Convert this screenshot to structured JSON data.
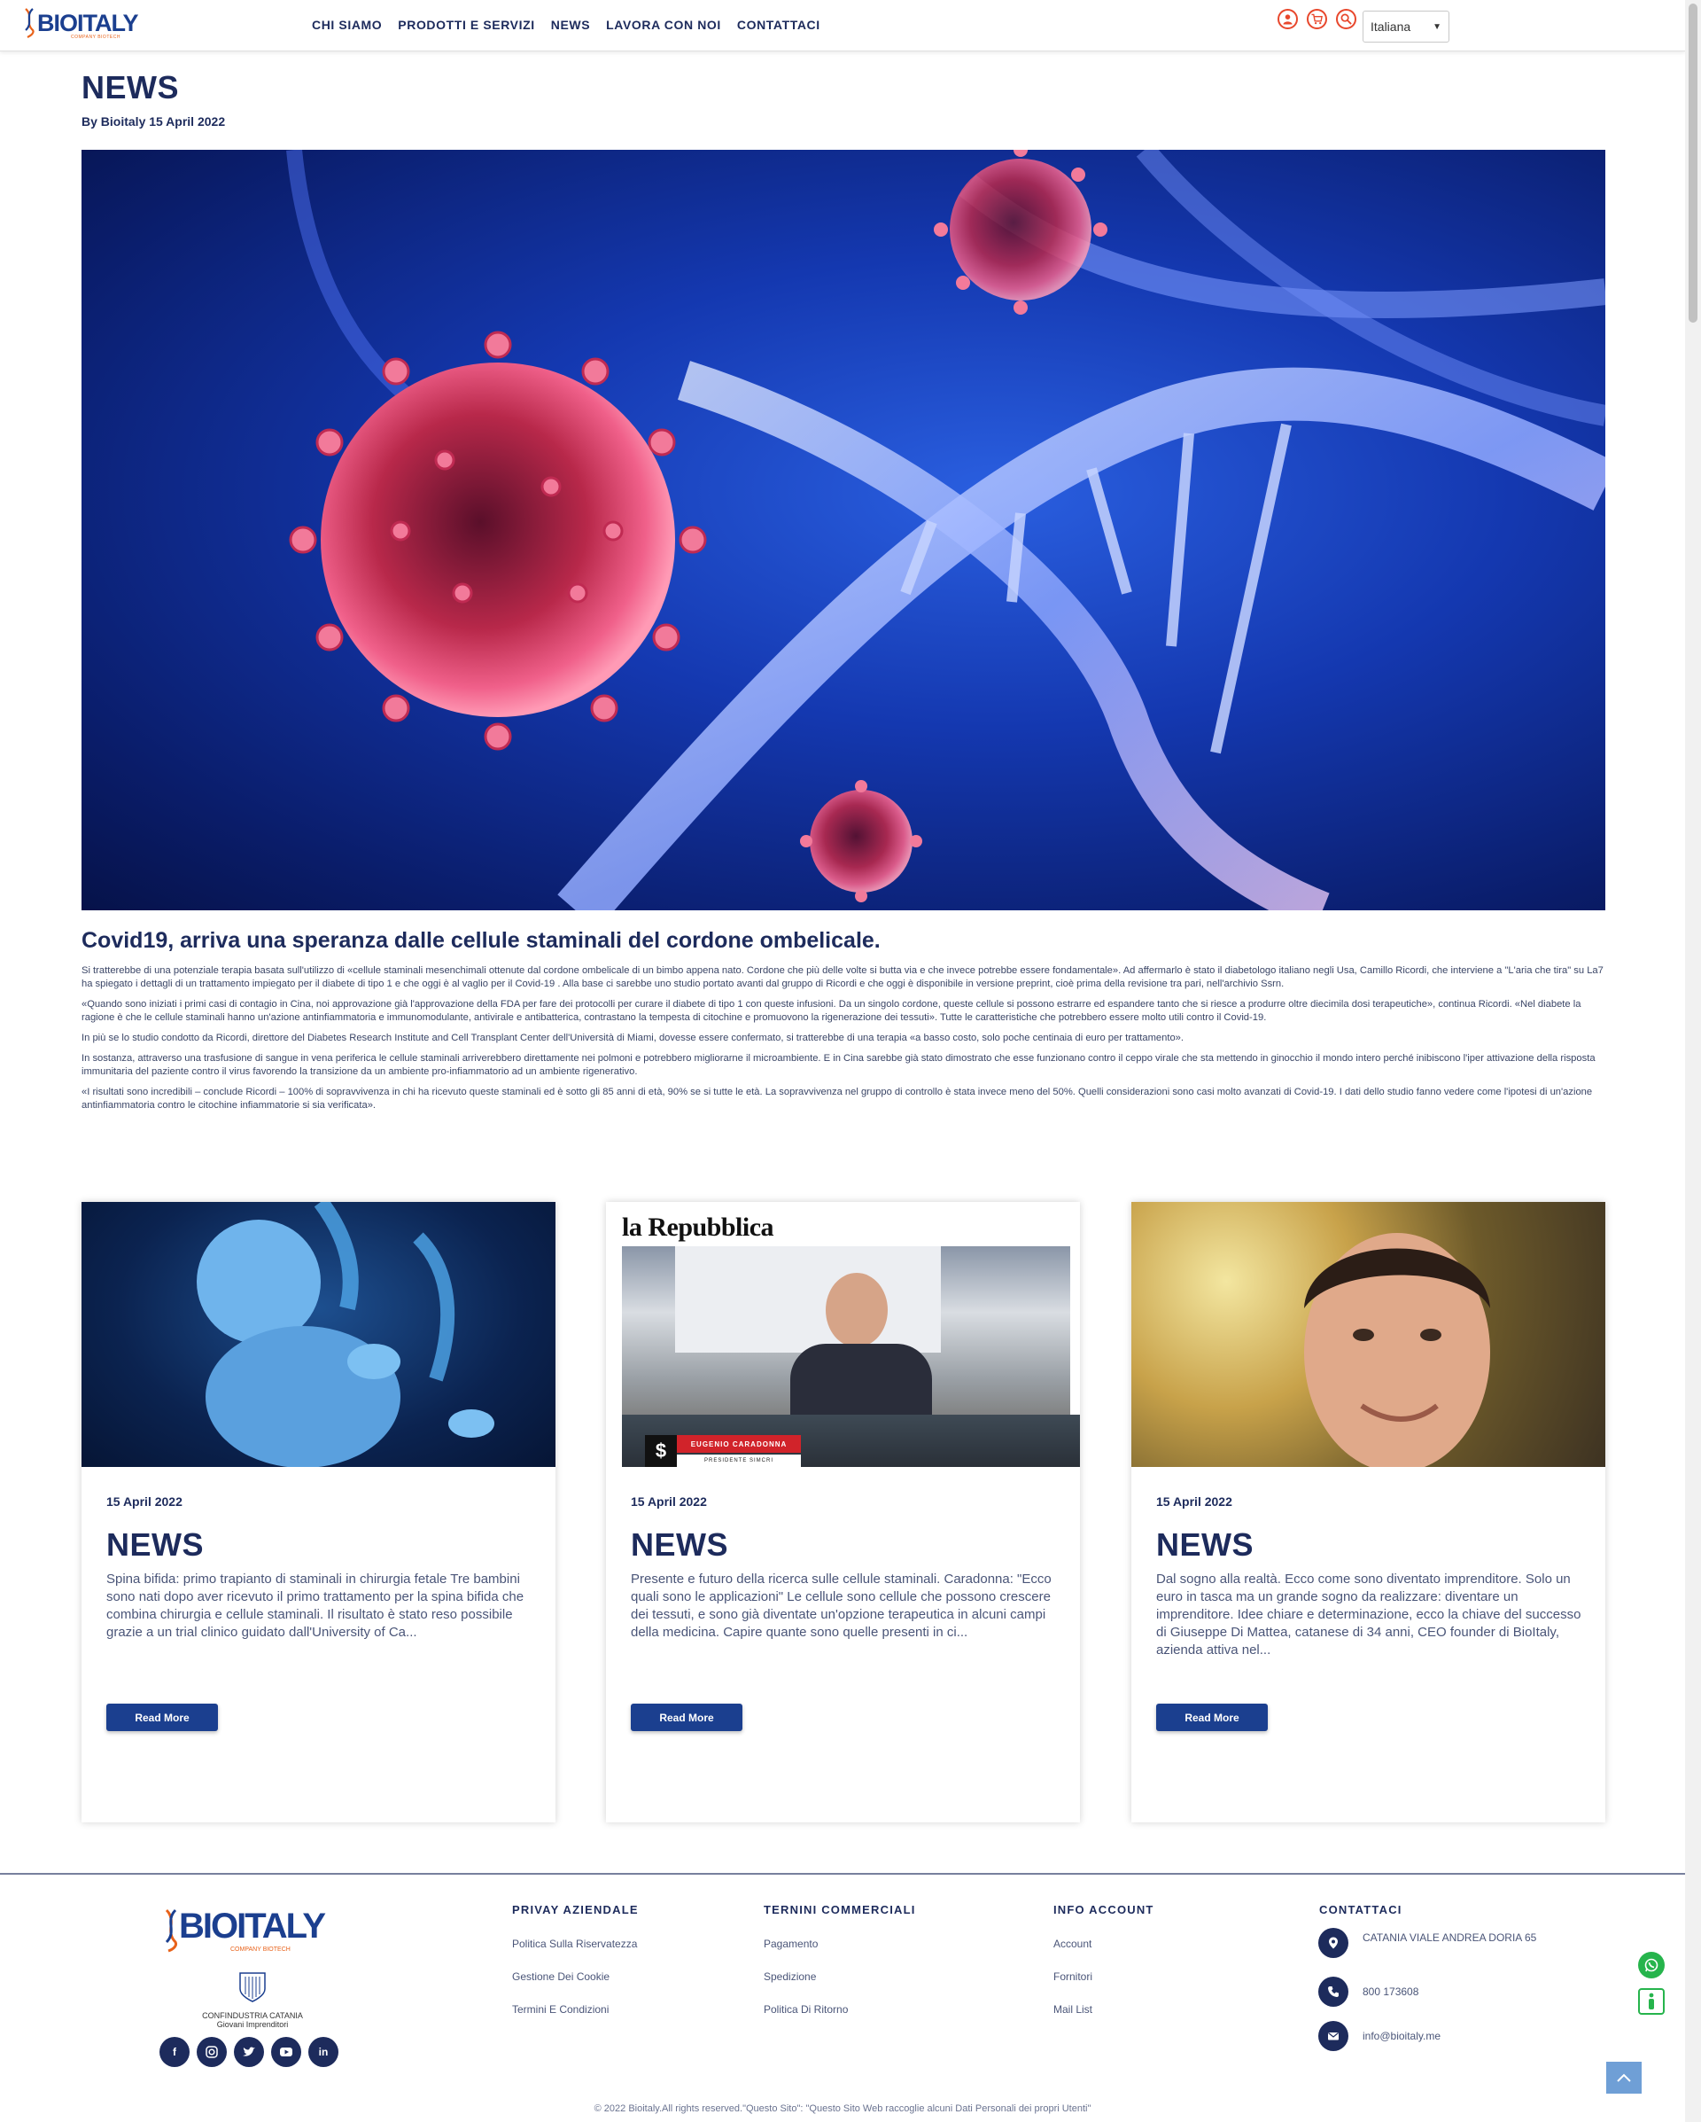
{
  "brand": {
    "name": "BIOITALY",
    "subtitle": "COMPANY BIOTECH",
    "accent_color": "#1b3f8f",
    "secondary_color": "#e8621a"
  },
  "nav": {
    "items": [
      "CHI SIAMO",
      "PRODOTTI E SERVIZI",
      "NEWS",
      "LAVORA CON NOI",
      "CONTATTACI"
    ]
  },
  "header_icons": [
    "user-icon",
    "cart-icon",
    "search-icon"
  ],
  "language": {
    "selected": "Italiana"
  },
  "article": {
    "title": "NEWS",
    "byline": "By Bioitaly 15 April 2022",
    "heading": "Covid19, arriva una speranza dalle cellule staminali del cordone ombelicale.",
    "paragraphs": [
      "Si tratterebbe di una potenziale terapia basata sull'utilizzo di «cellule staminali mesenchimali ottenute dal cordone ombelicale di un bimbo appena nato. Cordone che più delle volte si butta via e che invece potrebbe essere fondamentale». Ad affermarlo è stato il diabetologo italiano negli Usa, Camillo Ricordi, che interviene a \"L'aria che tira\" su La7 ha spiegato i dettagli di un trattamento impiegato per il diabete di tipo 1 e che oggi è al vaglio per il Covid-19 . Alla base ci sarebbe uno studio portato avanti dal gruppo di Ricordi e che oggi è disponibile in versione preprint, cioè prima della revisione tra pari, nell'archivio Ssrn.",
      "«Quando sono iniziati i primi casi di contagio in Cina, noi approvazione già l'approvazione della FDA per fare dei protocolli per curare il diabete di tipo 1 con queste infusioni. Da un singolo cordone, queste cellule si possono estrarre ed espandere tanto che si riesce a produrre oltre diecimila dosi terapeutiche», continua Ricordi. «Nel diabete la ragione è che le cellule staminali hanno un'azione antinfiammatoria e immunomodulante, antivirale e antibatterica, contrastano la tempesta di citochine e promuovono la rigenerazione dei tessuti». Tutte le caratteristiche che potrebbero essere molto utili contro il Covid-19.",
      "In più se lo studio condotto da Ricordi, direttore del Diabetes Research Institute and Cell Transplant Center dell'Università di Miami, dovesse essere confermato, si tratterebbe di una terapia «a basso costo, solo poche centinaia di euro per trattamento».",
      "In sostanza, attraverso una trasfusione di sangue in vena periferica le cellule staminali arriverebbero direttamente nei polmoni e potrebbero migliorarne il microambiente. E in Cina sarebbe già stato dimostrato che esse funzionano contro il ceppo virale che sta mettendo in ginocchio il mondo intero perché inibiscono l'iper attivazione della risposta immunitaria del paziente contro il virus favorendo la transizione da un ambiente pro-infiammatorio ad un ambiente rigenerativo.",
      "«I risultati sono incredibili – conclude Ricordi – 100% di sopravvivenza in chi ha ricevuto queste staminali ed è sotto gli 85 anni di età, 90% se si tutte le età. La sopravvivenza nel gruppo di controllo è stata invece meno del 50%. Quelli considerazioni sono casi molto avanzati di Covid-19. I dati dello studio fanno vedere come l'ipotesi di un'azione antinfiammatoria contro le citochine infiammatorie si sia verificata»."
    ]
  },
  "cards": [
    {
      "date": "15 April 2022",
      "title": "NEWS",
      "excerpt": "Spina bifida: primo trapianto di staminali in chirurgia fetale Tre bambini sono nati dopo aver ricevuto il primo trattamento per la spina bifida che combina chirurgia e cellule staminali. Il risultato è stato reso possibile grazie a un trial clinico guidato dall'University of Ca...",
      "button": "Read More"
    },
    {
      "date": "15 April 2022",
      "title": "NEWS",
      "excerpt": "Presente e futuro della ricerca sulle cellule staminali. Caradonna: \"Ecco quali sono le applicazioni\" Le cellule sono cellule che possono crescere dei tessuti, e sono già diventate un'opzione terapeutica in alcuni campi della medicina. Capire quante sono quelle presenti in ci...",
      "button": "Read More",
      "image_text": {
        "masthead": "la Repubblica",
        "caption_name": "EUGENIO CARADONNA",
        "caption_role": "PRESIDENTE SIMCRI"
      }
    },
    {
      "date": "15 April 2022",
      "title": "NEWS",
      "excerpt": "Dal sogno alla realtà. Ecco come sono diventato imprenditore. Solo un euro in tasca ma un grande sogno da realizzare: diventare un imprenditore. Idee chiare e determinazione, ecco la chiave del successo di Giuseppe Di Mattea, catanese di 34 anni, CEO founder di BioItaly, azienda attiva nel...",
      "button": "Read More"
    }
  ],
  "footer": {
    "confindustria": {
      "line1": "CONFINDUSTRIA CATANIA",
      "line2": "Giovani Imprenditori"
    },
    "socials": [
      "facebook-icon",
      "instagram-icon",
      "twitter-icon",
      "youtube-icon",
      "linkedin-icon"
    ],
    "columns": [
      {
        "head": "PRIVAY AZIENDALE",
        "links": [
          "Politica Sulla Riservatezza",
          "Gestione Dei Cookie",
          "Termini E Condizioni"
        ]
      },
      {
        "head": "TERNINI COMMERCIALI",
        "links": [
          "Pagamento",
          "Spedizione",
          "Politica Di Ritorno"
        ]
      },
      {
        "head": "INFO ACCOUNT",
        "links": [
          "Account",
          "Fornitori",
          "Mail List"
        ]
      }
    ],
    "contacts": {
      "head": "CONTATTACI",
      "address": "CATANIA VIALE ANDREA DORIA 65",
      "phone": "800 173608",
      "email": "info@bioitaly.me"
    },
    "copyright": "© 2022 Bioitaly.All rights reserved.\"Questo Sito\": \"Questo Sito Web raccoglie alcuni Dati Personali dei propri Utenti\""
  }
}
